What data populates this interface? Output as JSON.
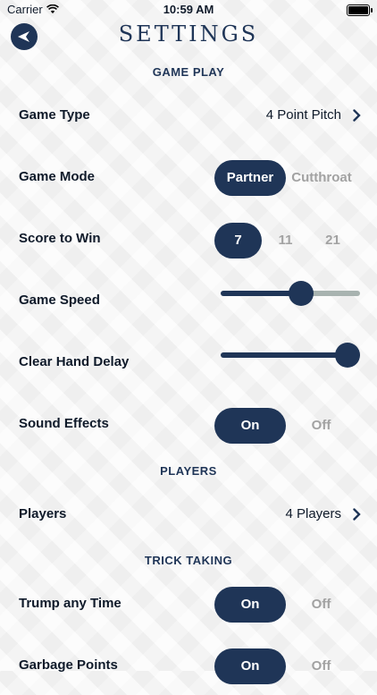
{
  "status_bar": {
    "carrier": "Carrier",
    "time": "10:59 AM"
  },
  "header": {
    "title": "SETTINGS",
    "back_icon": "back-arrow-icon"
  },
  "sections": {
    "game_play": "GAME PLAY",
    "players": "PLAYERS",
    "trick_taking": "TRICK TAKING"
  },
  "game_type": {
    "label": "Game Type",
    "value": "4 Point Pitch"
  },
  "game_mode": {
    "label": "Game Mode",
    "options": [
      "Partner",
      "Cutthroat"
    ],
    "selected": "Partner"
  },
  "score_to_win": {
    "label": "Score to Win",
    "options": [
      "7",
      "11",
      "21"
    ],
    "selected": "7"
  },
  "game_speed": {
    "label": "Game Speed",
    "level": 0.59
  },
  "clear_hand_delay": {
    "label": "Clear Hand Delay",
    "level": 1.0
  },
  "sound_effects": {
    "label": "Sound Effects",
    "options": [
      "On",
      "Off"
    ],
    "selected": "On"
  },
  "players": {
    "label": "Players",
    "value": "4 Players"
  },
  "trump_any_time": {
    "label": "Trump any Time",
    "options": [
      "On",
      "Off"
    ],
    "selected": "On"
  },
  "garbage_points": {
    "label": "Garbage Points",
    "options": [
      "On",
      "Off"
    ],
    "selected": "On"
  },
  "colors": {
    "accent": "#1f3557",
    "inactive": "#a2a2a2",
    "track": "#a8b3b0"
  }
}
